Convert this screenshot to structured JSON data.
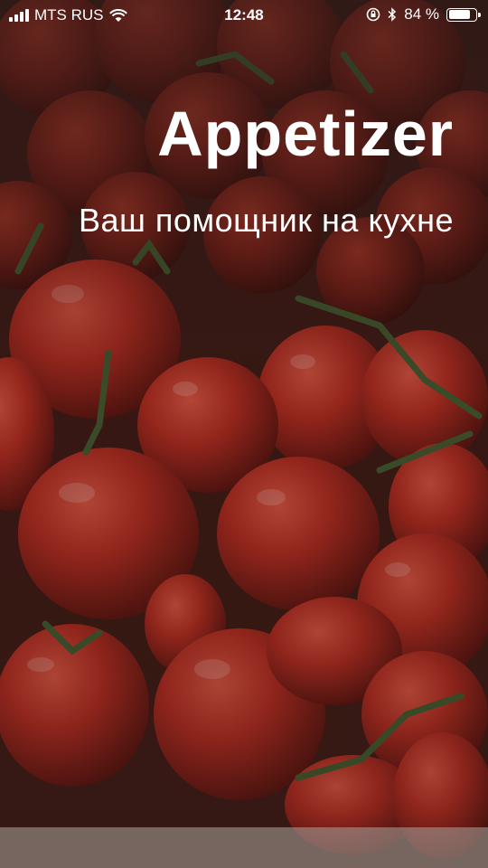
{
  "status_bar": {
    "carrier": "MTS RUS",
    "time": "12:48",
    "battery_percent": "84 %",
    "battery_level": 0.84,
    "icons": [
      "signal-icon",
      "wifi-icon",
      "orientation-lock-icon",
      "bluetooth-icon",
      "battery-icon"
    ]
  },
  "hero": {
    "title": "Appetizer",
    "tagline": "Ваш помощник на кухне"
  },
  "background": {
    "subject": "tomatoes-photo",
    "colors": {
      "tomato": "#b8281c",
      "stem": "#3f5a2c",
      "overlay": "#282020"
    }
  }
}
